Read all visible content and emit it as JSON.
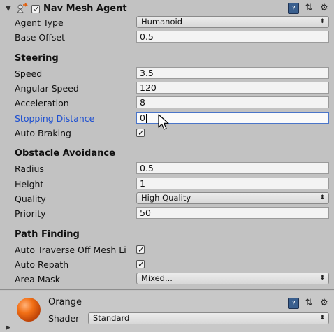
{
  "header": {
    "title": "Nav Mesh Agent",
    "icons": [
      "navmesh-agent-icon",
      "help-book-icon",
      "preset-sliders-icon",
      "settings-gear-icon"
    ]
  },
  "agent": {
    "agent_type_label": "Agent Type",
    "agent_type_value": "Humanoid",
    "base_offset_label": "Base Offset",
    "base_offset_value": "0.5"
  },
  "steering": {
    "title": "Steering",
    "speed_label": "Speed",
    "speed_value": "3.5",
    "angular_speed_label": "Angular Speed",
    "angular_speed_value": "120",
    "acceleration_label": "Acceleration",
    "acceleration_value": "8",
    "stopping_distance_label": "Stopping Distance",
    "stopping_distance_value": "0",
    "auto_braking_label": "Auto Braking"
  },
  "obstacle": {
    "title": "Obstacle Avoidance",
    "radius_label": "Radius",
    "radius_value": "0.5",
    "height_label": "Height",
    "height_value": "1",
    "quality_label": "Quality",
    "quality_value": "High Quality",
    "priority_label": "Priority",
    "priority_value": "50"
  },
  "path": {
    "title": "Path Finding",
    "auto_traverse_label": "Auto Traverse Off Mesh Li",
    "auto_repath_label": "Auto Repath",
    "area_mask_label": "Area Mask",
    "area_mask_value": "Mixed..."
  },
  "material": {
    "name": "Orange",
    "shader_label": "Shader",
    "shader_value": "Standard",
    "color": "#f27016"
  },
  "colors": {
    "panel_bg": "#c2c2c2",
    "focus_border": "#4a75c9",
    "active_label": "#1d4fd1"
  }
}
